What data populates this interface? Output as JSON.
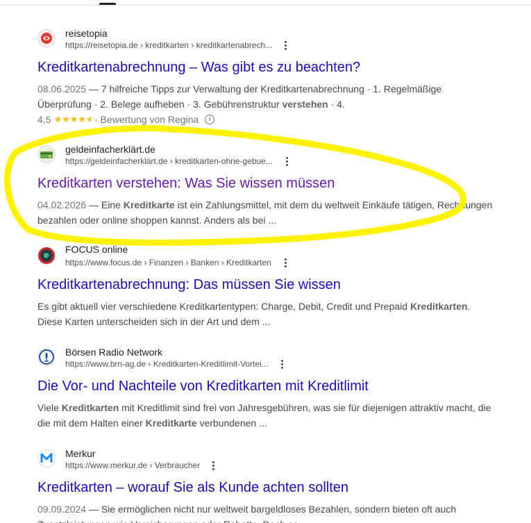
{
  "results": [
    {
      "site_name": "reisetopia",
      "site_url": "https://reisetopia.de › kreditkarten › kreditkartenabrech...",
      "title": "Kreditkartenabrechnung – Was gibt es zu beachten?",
      "date": "08.06.2025",
      "snippet_parts": [
        " — 7 hilfreiche Tipps zur Verwaltung der Kreditkartenabrechnung · 1. Regelmäßige Überprüfung · 2. Belege aufheben · 3. Gebührenstruktur ",
        "verstehen",
        " · 4."
      ],
      "rating": {
        "value": "4,5",
        "score": 4.5,
        "max": 5,
        "text": "· Bewertung von Regina"
      },
      "favicon_icon": "reisetopia-logo-icon",
      "visited": false
    },
    {
      "site_name": "geldeinfacherklärt.de",
      "site_url": "https://geldeinfacherklärt.de › kreditkarten-ohne-gebue...",
      "title": "Kreditkarten verstehen: Was Sie wissen müssen",
      "date": "04.02.2026",
      "snippet_parts": [
        " — Eine ",
        "Kreditkarte",
        " ist ein Zahlungsmittel, mit dem du weltweit Einkäufe tätigen, Rechnungen bezahlen oder online shoppen kannst. Anders als bei ..."
      ],
      "favicon_icon": "geldeinfacherklaert-logo-icon",
      "visited": true
    },
    {
      "site_name": "FOCUS online",
      "site_url": "https://www.focus.de › Finanzen › Banken › Kreditkarten",
      "title": "Kreditkartenabrechnung: Das müssen Sie wissen",
      "snippet_parts": [
        "Es gibt aktuell vier verschiedene Kreditkartentypen: Charge, Debit, Credit und Prepaid ",
        "Kreditkarten",
        ". Diese Karten unterscheiden sich in der Art und dem ..."
      ],
      "favicon_icon": "focus-online-logo-icon",
      "visited": false
    },
    {
      "site_name": "Börsen Radio Network",
      "site_url": "https://www.brn-ag.de › Kreditkarten-Kreditlimit-Vortei...",
      "title": "Die Vor- und Nachteile von Kreditkarten mit Kreditlimit",
      "snippet_parts": [
        "Viele ",
        "Kreditkarten",
        " mit Kreditlimit sind frei von Jahresgebühren, was sie für diejenigen attraktiv macht, die die mit dem Halten einer ",
        "Kreditkarte",
        " verbundenen ..."
      ],
      "favicon_icon": "brn-logo-icon",
      "visited": false
    },
    {
      "site_name": "Merkur",
      "site_url": "https://www.merkur.de › Verbraucher",
      "title": "Kreditkarten – worauf Sie als Kunde achten sollten",
      "date": "09.09.2024",
      "snippet_parts": [
        " — Sie ermöglichen nicht nur weltweit bargeldloses Bezahlen, sondern bieten oft auch Zusatzleistungen wie Versicherungen oder Rabatte. Doch so ..."
      ],
      "favicon_icon": "merkur-logo-icon",
      "visited": false
    }
  ],
  "colors": {
    "link": "#1a0dab",
    "visited_link": "#681da8",
    "annotation_highlight": "#fff200",
    "star": "#fbbc04"
  }
}
